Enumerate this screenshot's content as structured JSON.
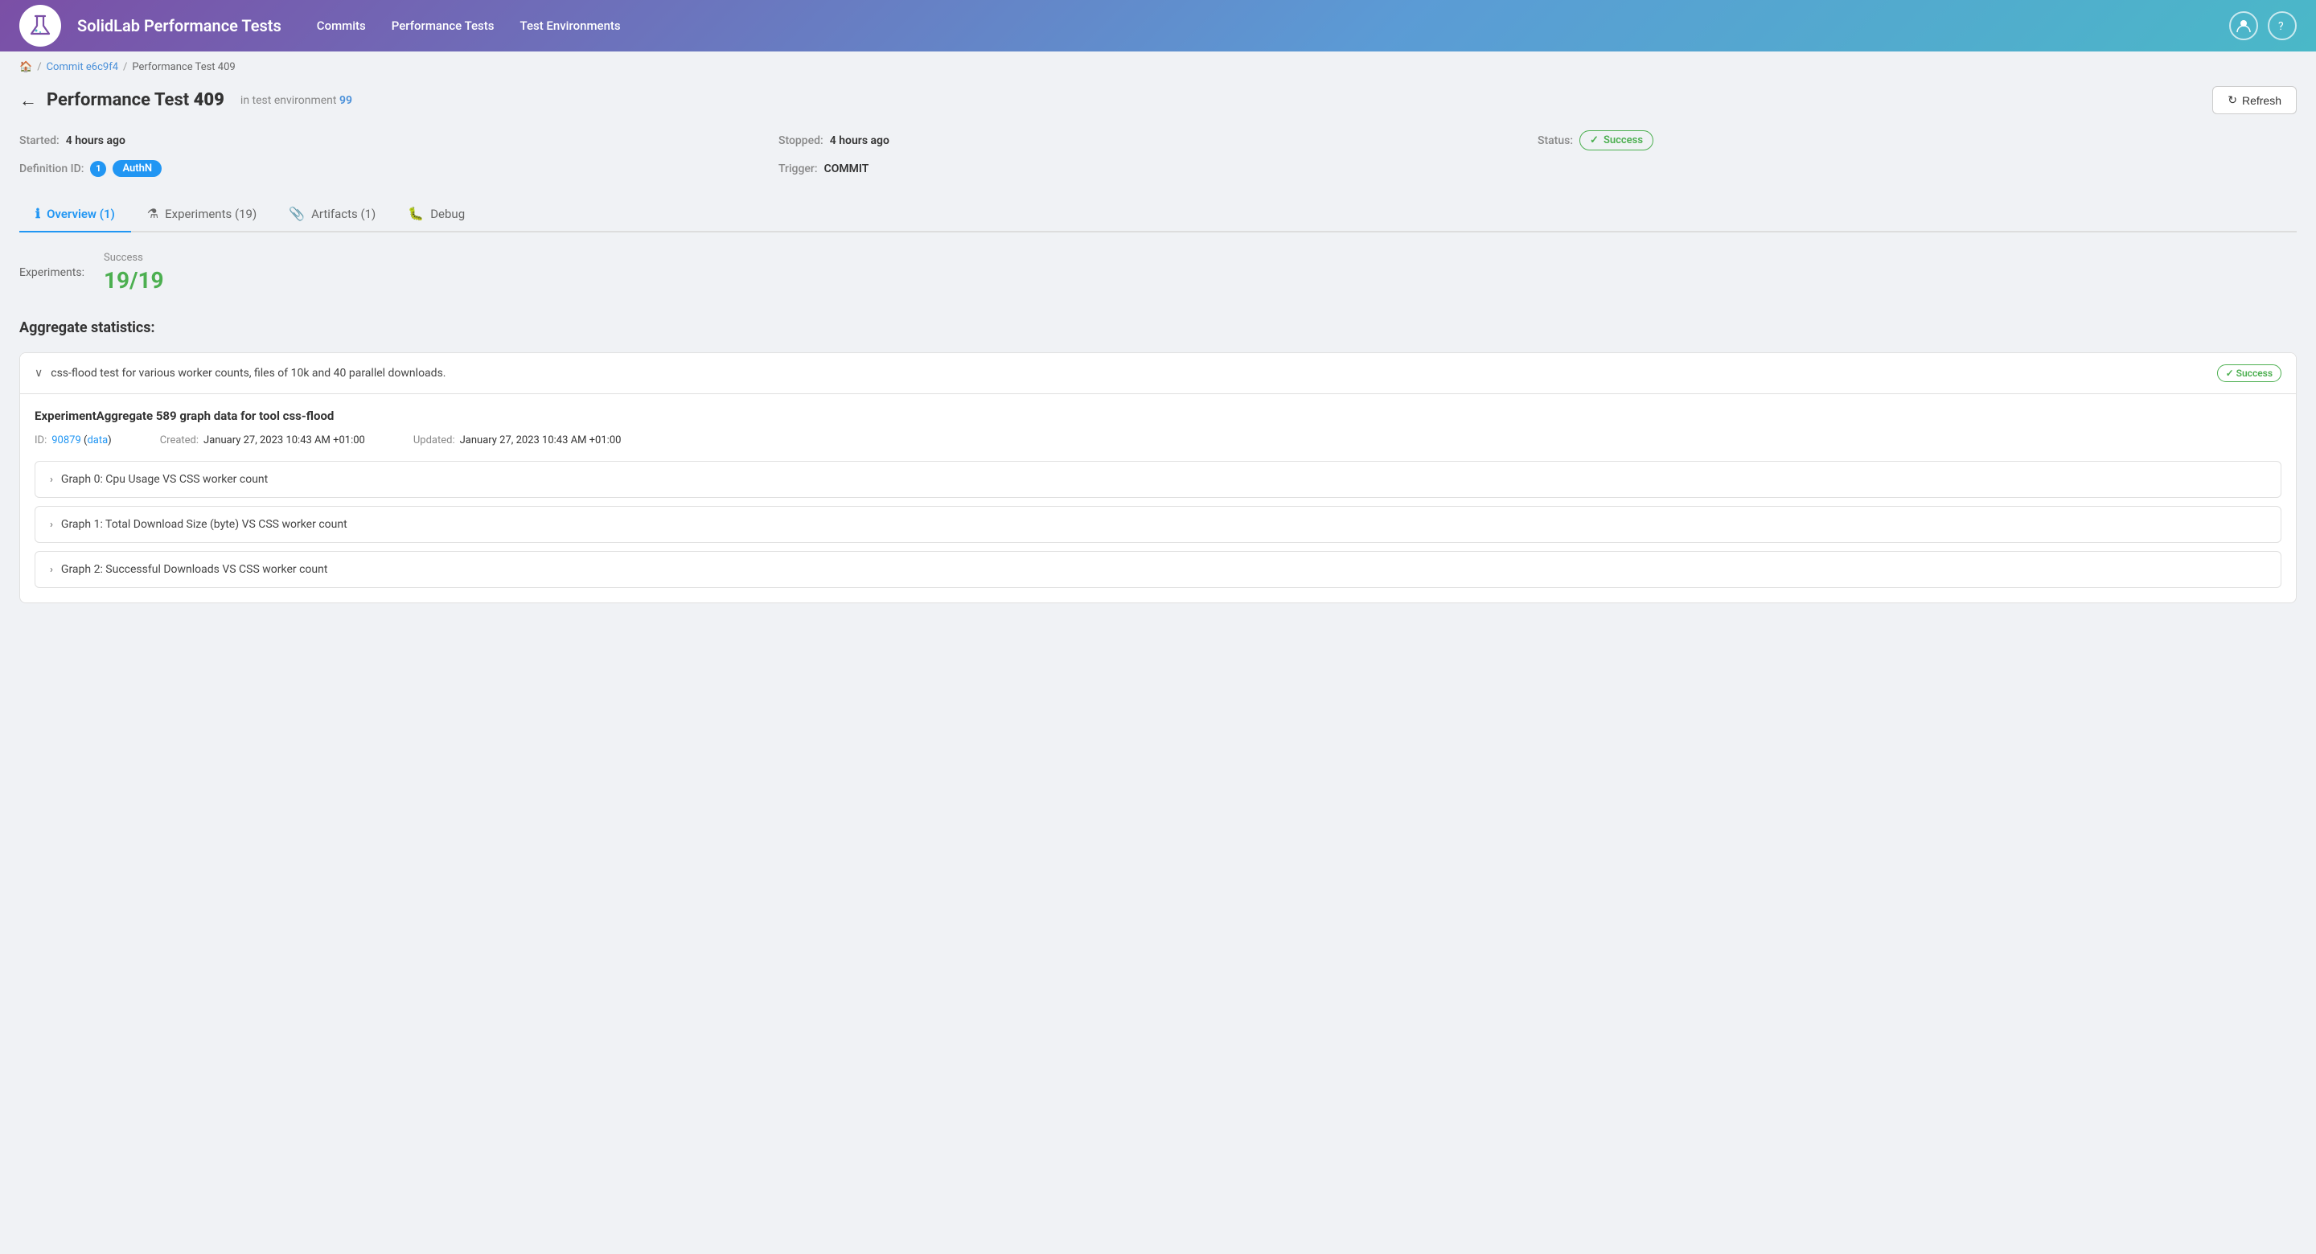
{
  "app": {
    "title": "SolidLab Performance Tests",
    "logo_alt": "flask-icon"
  },
  "header": {
    "nav": [
      {
        "label": "Commits",
        "id": "commits"
      },
      {
        "label": "Performance Tests",
        "id": "performance-tests"
      },
      {
        "label": "Test Environments",
        "id": "test-environments"
      }
    ]
  },
  "breadcrumb": {
    "home": "🏠",
    "items": [
      {
        "label": "Commit e6c9f4",
        "href": "#"
      },
      {
        "label": "Performance Test 409",
        "href": "#"
      }
    ]
  },
  "page": {
    "title_prefix": "Performance Test ",
    "title_bold": "409",
    "env_prefix": "in test environment",
    "env_number": "99",
    "back_label": "←",
    "refresh_label": "Refresh"
  },
  "meta": {
    "started_label": "Started:",
    "started_value": "4 hours ago",
    "stopped_label": "Stopped:",
    "stopped_value": "4 hours ago",
    "status_label": "Status:",
    "status_value": "Success",
    "definition_label": "Definition ID:",
    "definition_number": "1",
    "definition_tag": "AuthN",
    "trigger_label": "Trigger:",
    "trigger_value": "COMMIT"
  },
  "tabs": [
    {
      "label": "Overview (1)",
      "icon": "ℹ",
      "active": true
    },
    {
      "label": "Experiments (19)",
      "icon": "⚗",
      "active": false
    },
    {
      "label": "Artifacts (1)",
      "icon": "📎",
      "active": false
    },
    {
      "label": "Debug",
      "icon": "🐛",
      "active": false
    }
  ],
  "overview": {
    "experiments_label": "Experiments:",
    "experiments_heading": "Success",
    "experiments_value": "19/19",
    "aggregate_title": "Aggregate statistics:"
  },
  "experiment_card": {
    "chevron": "∨",
    "description": "css-flood test for various worker counts, files of 10k and 40 parallel downloads.",
    "status": "✓ Success",
    "agg_title": "ExperimentAggregate 589 graph data for tool css-flood",
    "id_label": "ID:",
    "id_value": "90879",
    "id_data_link": "data",
    "created_label": "Created:",
    "created_value": "January 27, 2023 10:43 AM +01:00",
    "updated_label": "Updated:",
    "updated_value": "January 27, 2023 10:43 AM +01:00",
    "graphs": [
      {
        "label": "Graph 0: Cpu Usage VS CSS worker count"
      },
      {
        "label": "Graph 1: Total Download Size (byte) VS CSS worker count"
      },
      {
        "label": "Graph 2: Successful Downloads VS CSS worker count"
      }
    ]
  }
}
